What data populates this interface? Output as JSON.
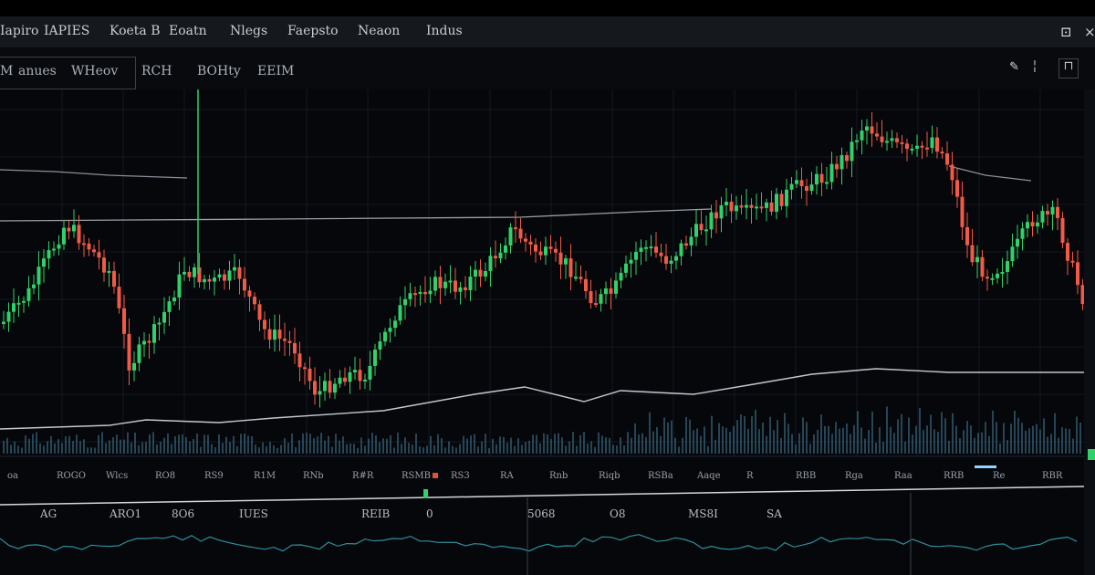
{
  "menubar": {
    "items": [
      "Iapiro",
      "IAPIES",
      "Koeta B",
      "Eoatn",
      "Nlegs",
      "Faepsto",
      "Neaon",
      "Indus"
    ],
    "window_controls": [
      "⊡",
      "×"
    ]
  },
  "toolbar": {
    "timeframes": [
      "M",
      "anues",
      "WHeov"
    ],
    "tools": [
      "RCH",
      "BOHty",
      "EEIM"
    ],
    "right_icons": [
      "pencil-icon",
      "ruler-icon",
      "lock-icon"
    ]
  },
  "chart_data": {
    "type": "candlestick",
    "up_color": "#2fd16a",
    "down_color": "#f05a47",
    "grid": true,
    "price_axis_visible": true,
    "indicator_lines": 2,
    "volume_panel": true,
    "time_labels": [
      "oa",
      "ROGO",
      "Wlcs",
      "RO8",
      "RS9",
      "R1M",
      "RNb",
      "R#R",
      "RSMB",
      "RS3",
      "RA",
      "Rnb",
      "Riqb",
      "RSBa",
      "Aaqe",
      "R",
      "RBB",
      "Rga",
      "Raa",
      "RRB",
      "Re",
      "RBR"
    ],
    "lower_labels": [
      "AG",
      "ARO1",
      "8O6",
      "IUES",
      "REIB",
      "0",
      "5068",
      "O8",
      "MS8I",
      "SA"
    ]
  }
}
